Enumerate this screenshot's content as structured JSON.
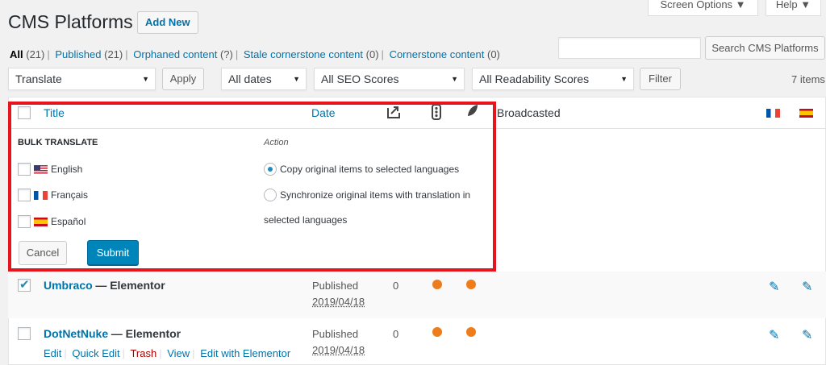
{
  "header": {
    "title": "CMS Platforms",
    "add_new": "Add New",
    "screen_options": "Screen Options ▼",
    "help": "Help ▼"
  },
  "views": [
    {
      "label": "All",
      "count": "(21)"
    },
    {
      "label": "Published",
      "count": "(21)"
    },
    {
      "label": "Orphaned content",
      "count": "(?)"
    },
    {
      "label": "Stale cornerstone content",
      "count": "(0)"
    },
    {
      "label": "Cornerstone content",
      "count": "(0)"
    }
  ],
  "search": {
    "placeholder": "",
    "button": "Search CMS Platforms"
  },
  "filters": {
    "bulk_action": "Translate",
    "apply": "Apply",
    "dates": "All dates",
    "seo": "All SEO Scores",
    "readability": "All Readability Scores",
    "filter": "Filter",
    "items_count": "7 items"
  },
  "table_head": {
    "title": "Title",
    "date": "Date",
    "broadcasted": "Broadcasted"
  },
  "bulk_translate": {
    "heading": "BULK TRANSLATE",
    "action_heading": "Action",
    "languages": [
      "English",
      "Français",
      "Español"
    ],
    "option_copy": "Copy original items to selected languages",
    "option_sync_line1": "Synchronize original items with translation in",
    "option_sync_line2": "selected languages",
    "cancel": "Cancel",
    "submit": "Submit"
  },
  "rows": [
    {
      "title": "Umbraco",
      "suffix": "— Elementor",
      "status": "Published",
      "date": "2019/04/18",
      "count": "0",
      "checked": true
    },
    {
      "title": "DotNetNuke",
      "suffix": "— Elementor",
      "status": "Published",
      "date": "2019/04/18",
      "count": "0",
      "checked": false
    }
  ],
  "row_actions": [
    "Edit",
    "Quick Edit",
    "Trash",
    "View",
    "Edit with Elementor"
  ],
  "colors": {
    "accent": "#0073aa",
    "highlight": "#e8141c",
    "score_dot": "#ee7c1b",
    "primary_button": "#0085ba"
  }
}
